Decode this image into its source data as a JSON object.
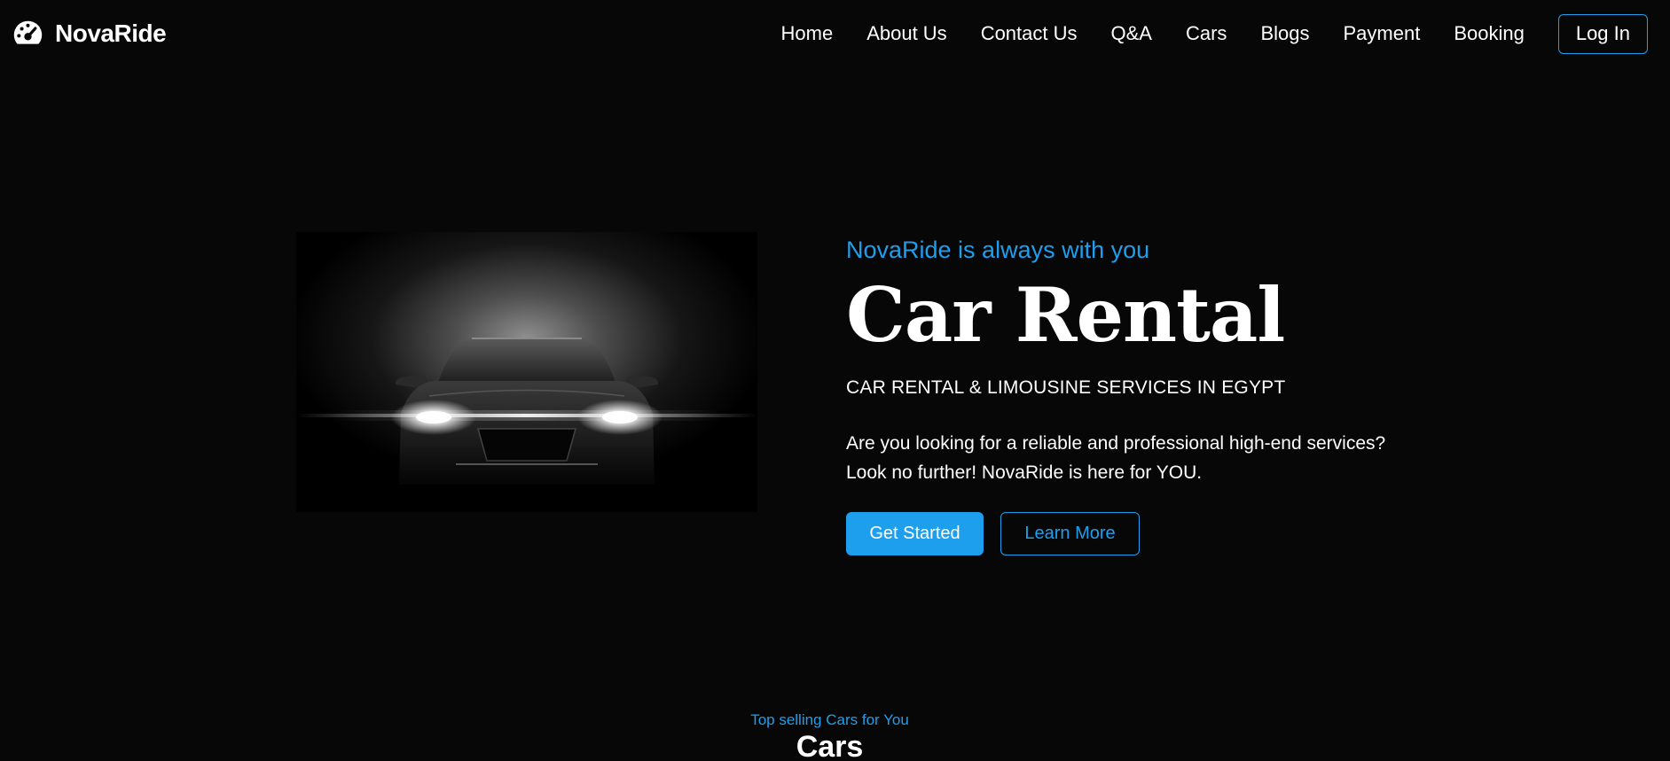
{
  "header": {
    "brand_name": "NovaRide",
    "brand_icon": "speedometer-icon",
    "nav_links": [
      "Home",
      "About Us",
      "Contact Us",
      "Q&A",
      "Cars",
      "Blogs",
      "Payment",
      "Booking"
    ],
    "login_label": "Log In"
  },
  "hero": {
    "tagline": "NovaRide is always with you",
    "title": "Car Rental",
    "subtitle": "CAR RENTAL & LIMOUSINE SERVICES IN EGYPT",
    "description_line1": "Are you looking for a reliable and professional high-end services?",
    "description_line2": "Look no further! NovaRide is here for YOU.",
    "primary_button": "Get Started",
    "secondary_button": "Learn More"
  },
  "cars_section": {
    "kicker": "Top selling Cars for You",
    "title": "Cars"
  },
  "colors": {
    "background": "#070707",
    "accent": "#1e9fee",
    "text": "#ffffff"
  }
}
